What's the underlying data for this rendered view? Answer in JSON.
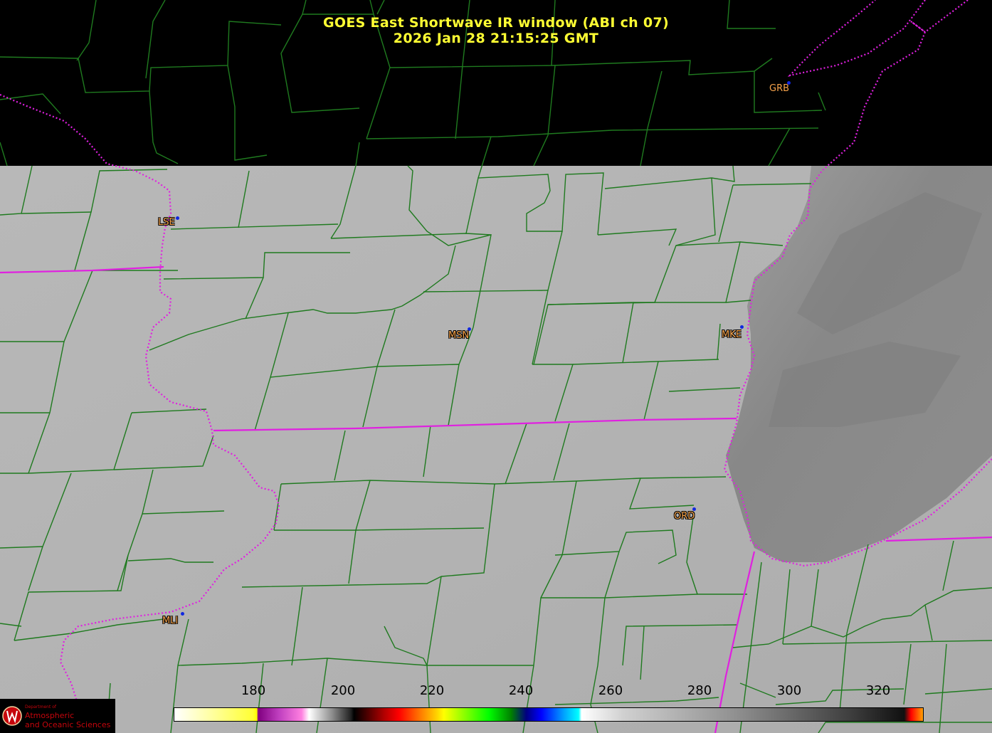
{
  "title": {
    "line1": "GOES East Shortwave IR window (ABI ch 07)",
    "line2": "2026 Jan 28  21:15:25 GMT"
  },
  "stations": [
    {
      "id": "GRB",
      "outlined": false
    },
    {
      "id": "LSE",
      "outlined": true
    },
    {
      "id": "MSN",
      "outlined": true
    },
    {
      "id": "MKE",
      "outlined": true
    },
    {
      "id": "ORD",
      "outlined": true
    },
    {
      "id": "MLI",
      "outlined": true
    }
  ],
  "colorbar": {
    "ticks": [
      "180",
      "200",
      "220",
      "240",
      "260",
      "280",
      "300",
      "320"
    ],
    "range": [
      163,
      331
    ]
  },
  "logo": {
    "dept": "Department of",
    "line1": "Atmospheric",
    "line2": "and Oceanic Sciences"
  },
  "colors": {
    "title": "#ffff33",
    "county_lines": "#1f7a1f",
    "state_lines": "#e020e0",
    "station_label": "#f6a34b",
    "station_marker": "#1028e0",
    "land_gray": "#b2b2b2",
    "lake_gray": "#8c8c8c"
  }
}
